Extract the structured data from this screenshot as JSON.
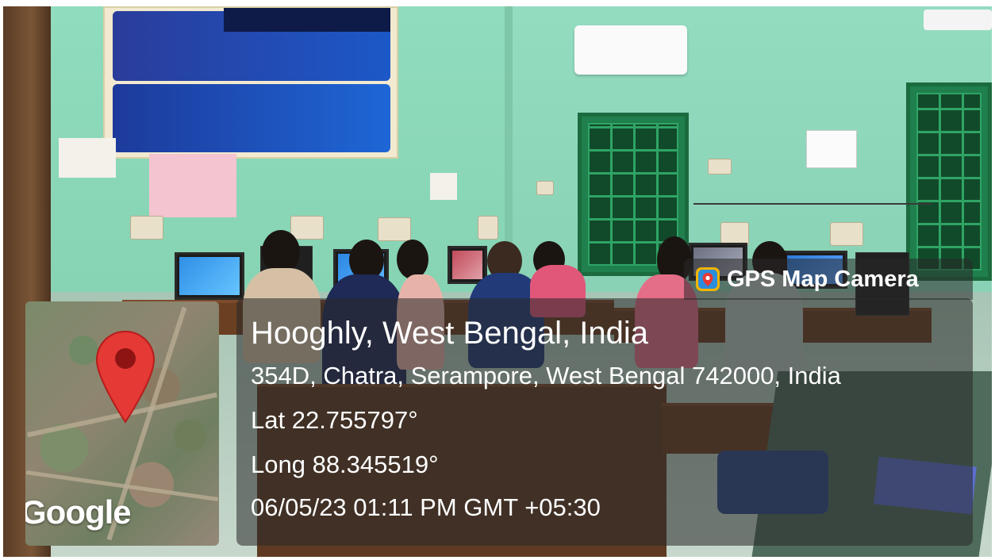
{
  "overlay": {
    "brand": "GPS Map Camera",
    "location_title": "Hooghly, West Bengal, India",
    "address": "354D, Chatra, Serampore, West Bengal 742000, India",
    "latitude": "Lat 22.755797°",
    "longitude": "Long 88.345519°",
    "datetime": "06/05/23 01:11 PM GMT +05:30",
    "map_logo": "Google",
    "icons": {
      "camera": "gps-map-camera-icon",
      "pin": "map-pin-icon"
    },
    "colors": {
      "pin": "#e53935",
      "panel": "rgba(40,40,40,0.55)",
      "text": "#ffffff"
    }
  }
}
